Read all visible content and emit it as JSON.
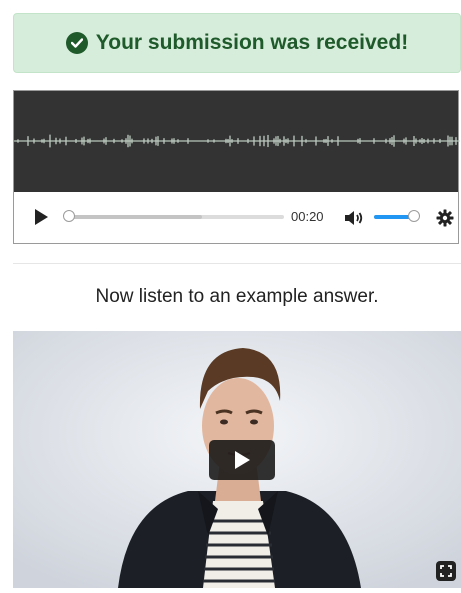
{
  "alert": {
    "message": "Your submission was received!",
    "icon": "check-circle-icon",
    "color": "#1f5a2b",
    "background": "#d7eddb"
  },
  "audio_player": {
    "time": "00:20",
    "progress": 0.0,
    "buffered": 0.62,
    "volume": 0.95,
    "icons": [
      "play-icon",
      "volume-icon",
      "settings-gear-icon"
    ],
    "accent": "#2196f3",
    "waveform_color": "#c8d8cc"
  },
  "instruction": "Now listen to an example answer.",
  "video": {
    "icons": [
      "play-icon",
      "fullscreen-icon"
    ]
  }
}
